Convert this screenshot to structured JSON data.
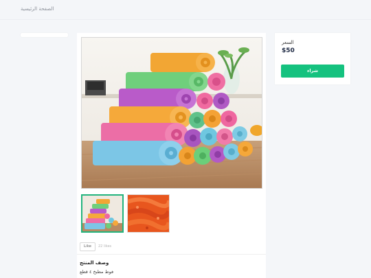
{
  "breadcrumb": {
    "home": "الصفحة الرئيسية"
  },
  "product": {
    "description_title": "وصف المنتج",
    "description_text": "فوط مطبخ ٤ قطع",
    "like_label": "Like",
    "likes_count": "22 likes",
    "thumbnails": [
      "towel-stack-thumbnail",
      "orange-towel-closeup-thumbnail"
    ]
  },
  "purchase": {
    "price_label": "السعر",
    "price_value": "$50",
    "buy_label": "شراء"
  },
  "colors": {
    "accent": "#15c27f",
    "background": "#f4f6f9"
  },
  "icons": []
}
